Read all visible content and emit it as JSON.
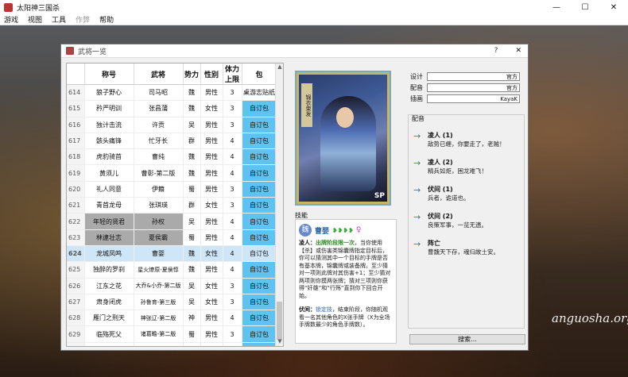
{
  "window": {
    "title": "太阳神三国杀",
    "controls": {
      "minimize": "—",
      "maximize": "☐",
      "close": "✕"
    }
  },
  "menu": [
    {
      "label": "游戏",
      "disabled": false
    },
    {
      "label": "视图",
      "disabled": false
    },
    {
      "label": "工具",
      "disabled": false
    },
    {
      "label": "作弊",
      "disabled": true
    },
    {
      "label": "帮助",
      "disabled": false
    }
  ],
  "watermark": "anguosha.org",
  "dialog": {
    "title": "武将一览",
    "help": "?",
    "close": "✕"
  },
  "table": {
    "headers": [
      "称号",
      "武将",
      "势力",
      "性别",
      "体力上限",
      "包"
    ],
    "rows": [
      {
        "num": "614",
        "title": "狼子野心",
        "name": "司马昭",
        "kingdom": "魏",
        "gender": "男性",
        "hp": "3",
        "pkg": "桌游志贴纸",
        "style": "plain"
      },
      {
        "num": "615",
        "title": "矜严明训",
        "name": "张昌蒲",
        "kingdom": "魏",
        "gender": "女性",
        "hp": "3",
        "pkg": "自订包",
        "style": "blue"
      },
      {
        "num": "616",
        "title": "独计击流",
        "name": "许贡",
        "kingdom": "吴",
        "gender": "男性",
        "hp": "3",
        "pkg": "自订包",
        "style": "blue"
      },
      {
        "num": "617",
        "title": "骸头痛锋",
        "name": "忙牙长",
        "kingdom": "群",
        "gender": "男性",
        "hp": "4",
        "pkg": "自订包",
        "style": "blue"
      },
      {
        "num": "618",
        "title": "虎豹骑首",
        "name": "曹纯",
        "kingdom": "魏",
        "gender": "男性",
        "hp": "4",
        "pkg": "自订包",
        "style": "blue"
      },
      {
        "num": "619",
        "title": "黄须儿",
        "name": "曹彰-第二版",
        "kingdom": "魏",
        "gender": "男性",
        "hp": "4",
        "pkg": "自订包",
        "style": "blue"
      },
      {
        "num": "620",
        "title": "礼人同意",
        "name": "伊籍",
        "kingdom": "蜀",
        "gender": "男性",
        "hp": "3",
        "pkg": "自订包",
        "style": "blue"
      },
      {
        "num": "621",
        "title": "青首龙母",
        "name": "张琪瑛",
        "kingdom": "群",
        "gender": "女性",
        "hp": "3",
        "pkg": "自订包",
        "style": "blue"
      },
      {
        "num": "622",
        "title": "年轻的贤君",
        "name": "孙权",
        "kingdom": "吴",
        "gender": "男性",
        "hp": "4",
        "pkg": "自订包",
        "style": "gray"
      },
      {
        "num": "623",
        "title": "林逮壮志",
        "name": "夏侯霸",
        "kingdom": "蜀",
        "gender": "男性",
        "hp": "4",
        "pkg": "自订包",
        "style": "gray"
      },
      {
        "num": "624",
        "title": "龙城凤鸣",
        "name": "曹婴",
        "kingdom": "魏",
        "gender": "女性",
        "hp": "4",
        "pkg": "自订包",
        "style": "sel"
      },
      {
        "num": "625",
        "title": "独醉的罗刹",
        "name": "星火燎原-夏侯惇",
        "kingdom": "魏",
        "gender": "男性",
        "hp": "4",
        "pkg": "自订包",
        "style": "blue"
      },
      {
        "num": "626",
        "title": "江东之花",
        "name": "大乔&小乔-第二版",
        "kingdom": "吴",
        "gender": "女性",
        "hp": "3",
        "pkg": "自订包",
        "style": "blue"
      },
      {
        "num": "627",
        "title": "肃身闭虎",
        "name": "孙鲁育-第三版",
        "kingdom": "吴",
        "gender": "女性",
        "hp": "3",
        "pkg": "自订包",
        "style": "blue"
      },
      {
        "num": "628",
        "title": "雁门之刑天",
        "name": "神张辽-第二版",
        "kingdom": "神",
        "gender": "男性",
        "hp": "4",
        "pkg": "自订包",
        "style": "blue"
      },
      {
        "num": "629",
        "title": "临殇死父",
        "name": "诸葛瞻-第二版",
        "kingdom": "蜀",
        "gender": "男性",
        "hp": "3",
        "pkg": "自订包",
        "style": "blue"
      },
      {
        "num": "630",
        "title": "红莲业火",
        "name": "神陆逊-第二版",
        "kingdom": "神",
        "gender": "男性",
        "hp": "4",
        "pkg": "自订包",
        "style": "blue"
      },
      {
        "num": "631",
        "title": "忍威辩谋",
        "name": "吕虔-第二版",
        "kingdom": "魏",
        "gender": "男性",
        "hp": "4",
        "pkg": "自订包",
        "style": "blue"
      },
      {
        "num": "632",
        "title": "金壁之才",
        "name": "OL那文钦",
        "kingdom": "魏",
        "gender": "男性",
        "hp": "4",
        "pkg": "自订包",
        "style": "blue"
      }
    ]
  },
  "card": {
    "side_label": "锦衣束发",
    "corner": "SP"
  },
  "skills": {
    "label": "技能",
    "icon": "魏",
    "general_name": "曹婴",
    "hp_icons": "❥❥❥❥",
    "gender_icon": "♀",
    "s1_name": "凌人：",
    "s1_key": "出牌阶段限一次",
    "s1_text": "，当你使用【杀】或伤害类锦囊牌指定目标后，你可以猜测其中一个目标的手牌是否有基本牌，锦囊牌或装备牌。至少猜对一项则此牌对其伤害+1；至少猜对两项则你摸两张牌；猜对三项则你获得“奸雄”和“行殇”直到你下回合开始。",
    "s2_name": "伏间：",
    "s2_key": "锁定技",
    "s2_text": "，结束阶段，你随机观看一名其他角色的X张手牌（X为全场手牌数最少的角色手牌数）。"
  },
  "info": {
    "design_label": "设计",
    "design": "官方",
    "voice_label": "配音",
    "voice": "官方",
    "illus_label": "插画",
    "illus": "KayaK"
  },
  "quotes": {
    "label": "配音",
    "items": [
      {
        "who": "凌人 (1)",
        "line": "敌势已缠，你要走了，老贼！"
      },
      {
        "who": "凌人 (2)",
        "line": "精兵如炬，困龙难飞！"
      },
      {
        "who": "伏间 (1)",
        "line": "兵者，诡道也。"
      },
      {
        "who": "伏间 (2)",
        "line": "良策军事，一览无遗。"
      },
      {
        "who": "阵亡",
        "line": "曹魏天下存，魂归故土安。"
      }
    ]
  },
  "search": "搜索..."
}
